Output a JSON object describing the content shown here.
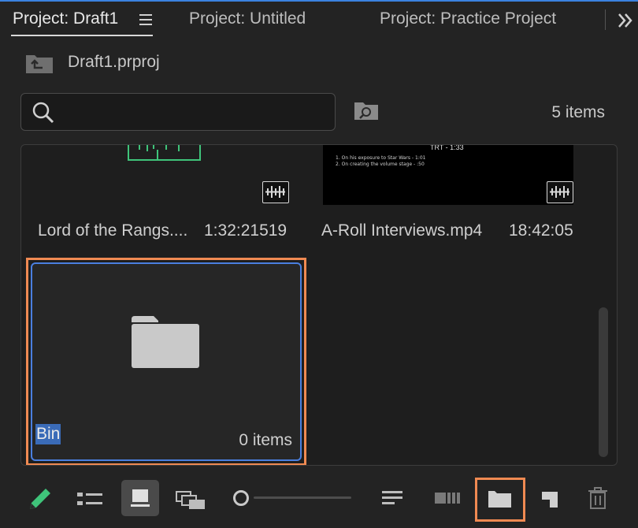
{
  "tabs": [
    {
      "label": "Project: Draft1",
      "active": true
    },
    {
      "label": "Project: Untitled",
      "active": false
    },
    {
      "label": "Project: Practice Project",
      "active": false
    }
  ],
  "path": {
    "label": "Draft1.prproj"
  },
  "search": {
    "value": "",
    "placeholder": ""
  },
  "item_count": "5 items",
  "clips": [
    {
      "name": "Lord of the Rangs....",
      "duration": "1:32:21519"
    },
    {
      "name": "A-Roll Interviews.mp4",
      "duration": "18:42:05"
    }
  ],
  "thumb2_text": {
    "tht": "TRT - 1:33",
    "line1": "1. On his exposure to Star Wars - 1:01",
    "line2": "2. On creating the volume stage - :50"
  },
  "bin": {
    "label": "Bin",
    "count": "0 items"
  },
  "colors": {
    "accent_blue": "#4a7fe0",
    "highlight_orange": "#f08a52",
    "pencil_green": "#3fc47a",
    "tab_underline": "#d8d8d8"
  },
  "toolbar": {
    "icons": [
      "pencil-icon",
      "list-view-icon",
      "icon-view-icon",
      "freeform-view-icon",
      "zoom-slider",
      "sort-icon",
      "automate-sequence-icon",
      "new-bin-icon",
      "new-item-icon",
      "trash-icon"
    ]
  }
}
